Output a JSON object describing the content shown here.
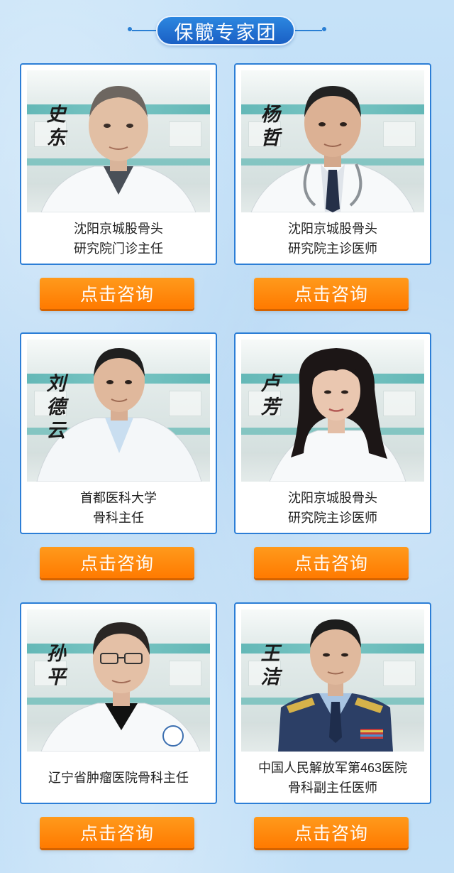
{
  "section_title": "保髋专家团",
  "cta_label": "点击咨询",
  "colors": {
    "title_pill": "#1a5fc4",
    "card_border": "#2c7ed6",
    "button": "#ff8a00",
    "background": "#bcdcf6"
  },
  "experts": [
    {
      "signature": "史东",
      "desc_line1": "沈阳京城股骨头",
      "desc_line2": "研究院门诊主任",
      "coat": "white",
      "tie": "none"
    },
    {
      "signature": "杨哲",
      "desc_line1": "沈阳京城股骨头",
      "desc_line2": "研究院主诊医师",
      "coat": "white",
      "tie": "dark"
    },
    {
      "signature": "刘德云",
      "desc_line1": "首都医科大学",
      "desc_line2": "骨科主任",
      "coat": "white",
      "tie": "none"
    },
    {
      "signature": "卢芳",
      "desc_line1": "沈阳京城股骨头",
      "desc_line2": "研究院主诊医师",
      "coat": "white",
      "tie": "none"
    },
    {
      "signature": "孙平",
      "desc_line1": "辽宁省肿瘤医院骨科主任",
      "desc_line2": "",
      "coat": "white",
      "tie": "none"
    },
    {
      "signature": "王洁",
      "desc_line1": "中国人民解放军第463医院",
      "desc_line2": "骨科副主任医师",
      "coat": "uniform",
      "tie": "dark"
    }
  ]
}
